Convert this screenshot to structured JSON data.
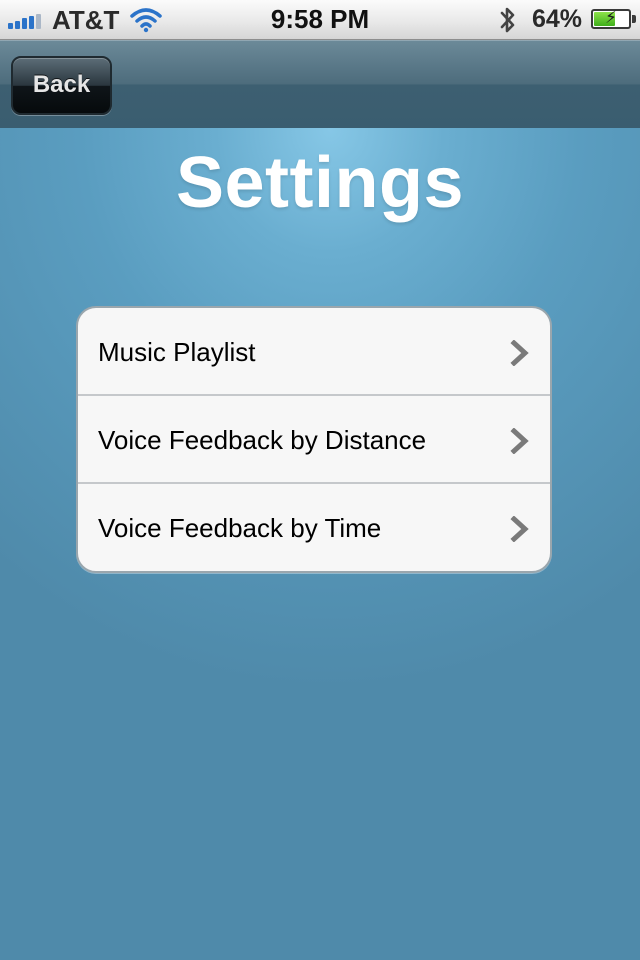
{
  "status_bar": {
    "carrier": "AT&T",
    "time": "9:58 PM",
    "battery_percent": "64%",
    "battery_level": 0.64,
    "icons": [
      "signal-bars-icon",
      "wifi-icon",
      "bluetooth-icon",
      "battery-charging-icon"
    ]
  },
  "nav": {
    "back_label": "Back"
  },
  "page": {
    "title": "Settings"
  },
  "settings": {
    "rows": [
      {
        "label": "Music Playlist",
        "icon": "chevron-right-icon"
      },
      {
        "label": "Voice Feedback by Distance",
        "icon": "chevron-right-icon"
      },
      {
        "label": "Voice Feedback by Time",
        "icon": "chevron-right-icon"
      }
    ]
  },
  "colors": {
    "background_highlight": "#86c7e6",
    "background_base": "#4f8aaa",
    "nav_bar": "#4d6c7c",
    "back_button": "#0f1519",
    "title_text": "#ffffff",
    "group_background": "#f7f7f7",
    "chevron": "#7a7a7a",
    "signal_active": "#2b73c9",
    "battery_fill": "#3fae1a"
  }
}
